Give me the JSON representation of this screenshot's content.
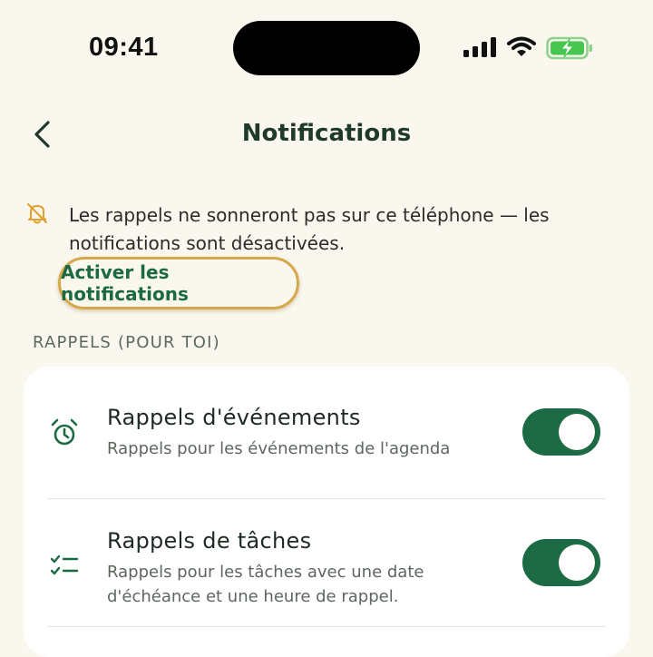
{
  "status_bar": {
    "time": "09:41"
  },
  "header": {
    "title": "Notifications"
  },
  "banner": {
    "message": "Les rappels ne sonneront pas sur ce téléphone — les notifications sont désactivées.",
    "action_label": "Activer les notifications"
  },
  "section": {
    "title": "RAPPELS (POUR TOI)"
  },
  "settings": [
    {
      "title": "Rappels d'événements",
      "description": "Rappels pour les événements de l'agenda",
      "enabled": true,
      "icon": "alarm-clock-icon"
    },
    {
      "title": "Rappels de tâches",
      "description": "Rappels pour les tâches avec une date d'échéance et une heure de rappel.",
      "enabled": true,
      "icon": "checklist-icon"
    }
  ],
  "colors": {
    "accent": "#1d6b45",
    "highlight": "#d4a84b",
    "warning": "#e0a030",
    "background": "#faf7ee"
  }
}
